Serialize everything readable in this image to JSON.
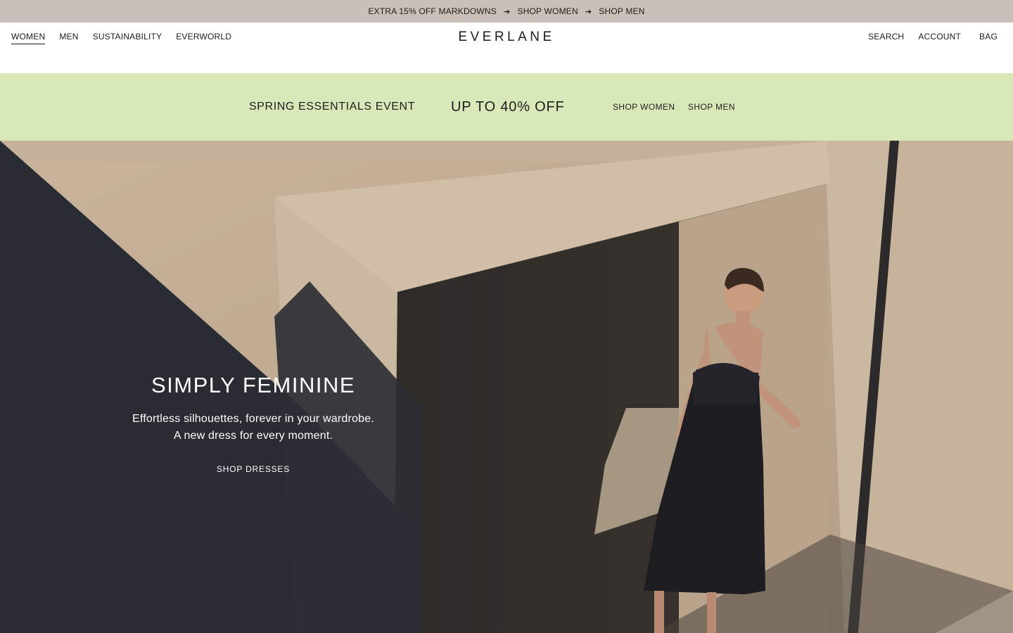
{
  "announcement": {
    "items": [
      "EXTRA 15% OFF MARKDOWNS",
      "SHOP WOMEN",
      "SHOP MEN"
    ],
    "arrow": "➔"
  },
  "header": {
    "nav_left": [
      "WOMEN",
      "MEN",
      "SUSTAINABILITY",
      "EVERWORLD"
    ],
    "active_item": "WOMEN",
    "logo": "EVERLANE",
    "nav_right": [
      "SEARCH",
      "ACCOUNT",
      "BAG"
    ]
  },
  "promo": {
    "event": "SPRING ESSENTIALS EVENT",
    "offer": "UP TO 40% OFF",
    "links": [
      "SHOP WOMEN",
      "SHOP MEN"
    ],
    "background": "#d9e8b9"
  },
  "hero": {
    "title": "SIMPLY FEMININE",
    "subtitle_line1": "Effortless silhouettes, forever in your wardrobe.",
    "subtitle_line2": "A new dress for every moment.",
    "cta": "SHOP DRESSES"
  },
  "colors": {
    "announcement_bg": "#c9c0ba",
    "wall": "#c2ad95",
    "shadow": "#2a2c33"
  }
}
